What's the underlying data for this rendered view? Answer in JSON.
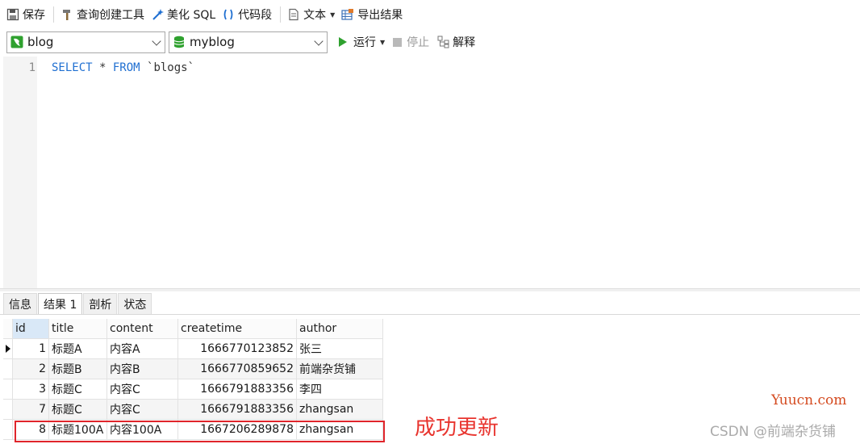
{
  "toolbar": {
    "save": "保存",
    "query_builder": "查询创建工具",
    "beautify_sql": "美化 SQL",
    "code_snippet": "代码段",
    "text": "文本",
    "export_results": "导出结果"
  },
  "selectors": {
    "connection": "blog",
    "database": "myblog",
    "run": "运行",
    "stop": "停止",
    "explain": "解释"
  },
  "editor": {
    "line_number": "1",
    "kw_select": "SELECT",
    "star": " * ",
    "kw_from": "FROM",
    "table": " `blogs`"
  },
  "tabs": [
    "信息",
    "结果 1",
    "剖析",
    "状态"
  ],
  "grid": {
    "columns": [
      "id",
      "title",
      "content",
      "createtime",
      "author"
    ],
    "rows": [
      {
        "id": "1",
        "title": "标题A",
        "content": "内容A",
        "createtime": "1666770123852",
        "author": "张三"
      },
      {
        "id": "2",
        "title": "标题B",
        "content": "内容B",
        "createtime": "1666770859652",
        "author": "前端杂货铺"
      },
      {
        "id": "3",
        "title": "标题C",
        "content": "内容C",
        "createtime": "1666791883356",
        "author": "李四"
      },
      {
        "id": "7",
        "title": "标题C",
        "content": "内容C",
        "createtime": "1666791883356",
        "author": "zhangsan"
      },
      {
        "id": "8",
        "title": "标题100A",
        "content": "内容100A",
        "createtime": "1667206289878",
        "author": "zhangsan"
      }
    ]
  },
  "annotation": "成功更新",
  "watermark_top": "Yuucn.com",
  "watermark_bottom": "CSDN @前端杂货铺",
  "colors": {
    "keyword": "#1f6fd1",
    "run_icon": "#2fa12f",
    "annotation": "#e8342e",
    "highlight_border": "#e0252b"
  }
}
